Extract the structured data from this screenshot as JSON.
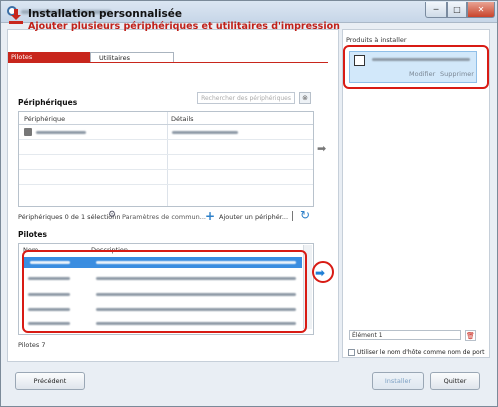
{
  "window": {
    "min_symbol": "─",
    "max_symbol": "□",
    "close_symbol": "✕"
  },
  "header": {
    "title": "Installation personnalisée",
    "subtitle": "Ajouter plusieurs périphériques et utilitaires d'impression"
  },
  "tabs": [
    {
      "label": "Pilotes"
    },
    {
      "label": "Utilitaires"
    }
  ],
  "devices": {
    "heading": "Périphériques",
    "search_placeholder": "Rechercher des périphériques",
    "columns": [
      "Périphérique",
      "Détails"
    ],
    "status": "Périphériques 0 de 1 sélectionn",
    "comm_settings": "Paramètres de commun...",
    "add_device": "Ajouter un périphér..."
  },
  "drivers": {
    "heading": "Pilotes",
    "columns": [
      "Nom",
      "Description"
    ],
    "count": "Pilotes 7"
  },
  "right": {
    "label": "Produits à installer",
    "modify": "Modifier",
    "remove": "Supprimer",
    "element": "Élément 1",
    "hostname_checkbox": "Utiliser le nom d'hôte comme nom de port"
  },
  "buttons": {
    "previous": "Précédent",
    "install": "Installer",
    "quit": "Quitter"
  },
  "colors": {
    "accent": "#c8261c",
    "selection": "#3a8de0",
    "highlight_box": "#d81b14"
  }
}
